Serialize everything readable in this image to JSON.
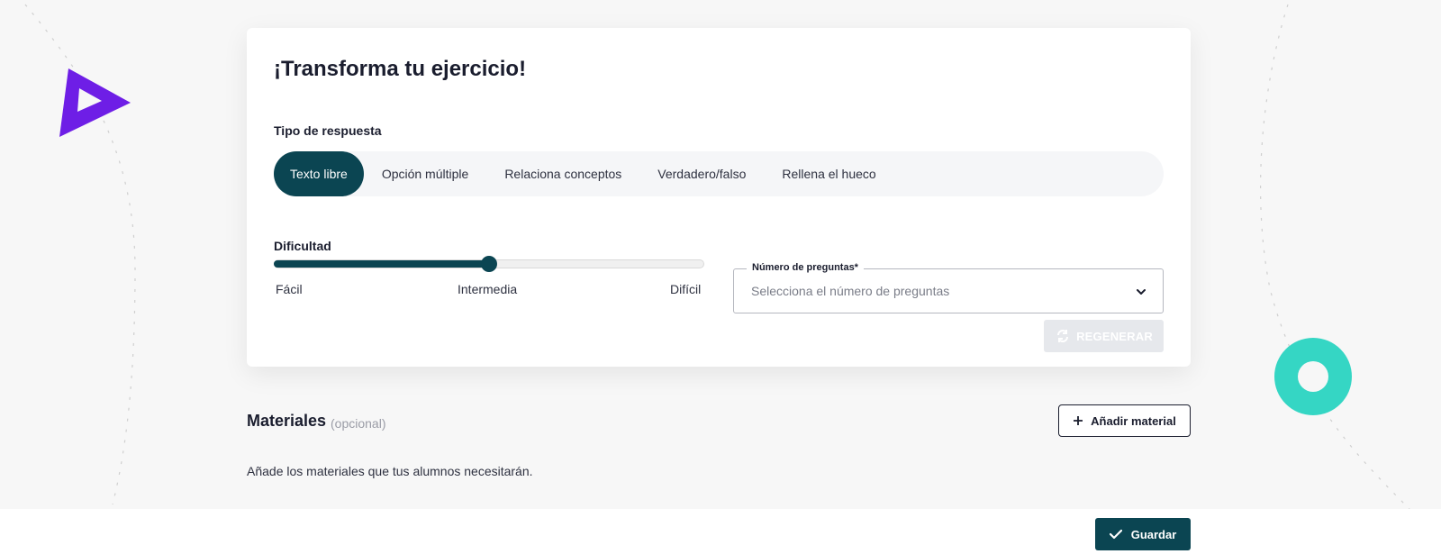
{
  "card": {
    "title": "¡Transforma tu ejercicio!",
    "answer_type_label": "Tipo de respuesta",
    "tabs": [
      {
        "label": "Texto libre",
        "active": true
      },
      {
        "label": "Opción múltiple",
        "active": false
      },
      {
        "label": "Relaciona conceptos",
        "active": false
      },
      {
        "label": "Verdadero/falso",
        "active": false
      },
      {
        "label": "Rellena el hueco",
        "active": false
      }
    ],
    "difficulty": {
      "label": "Dificultad",
      "level_fraction": 0.5,
      "ticks": [
        "Fácil",
        "Intermedia",
        "Difícil"
      ]
    },
    "questions_select": {
      "legend": "Número de preguntas*",
      "placeholder": "Selecciona el número de preguntas"
    },
    "regenerate_label": "REGENERAR"
  },
  "materials": {
    "title": "Materiales",
    "optional_note": "(opcional)",
    "description": "Añade los materiales que tus alumnos necesitarán.",
    "add_label": "Añadir material"
  },
  "footer": {
    "save_label": "Guardar"
  },
  "colors": {
    "primary": "#0b4552",
    "accent_purple": "#6e1ee6",
    "accent_teal": "#35d6c4",
    "disabled": "#e6e8ec"
  },
  "icons": {
    "regenerate": "refresh-icon",
    "add": "plus-icon",
    "save": "check-icon",
    "select": "chevron-down-icon"
  }
}
